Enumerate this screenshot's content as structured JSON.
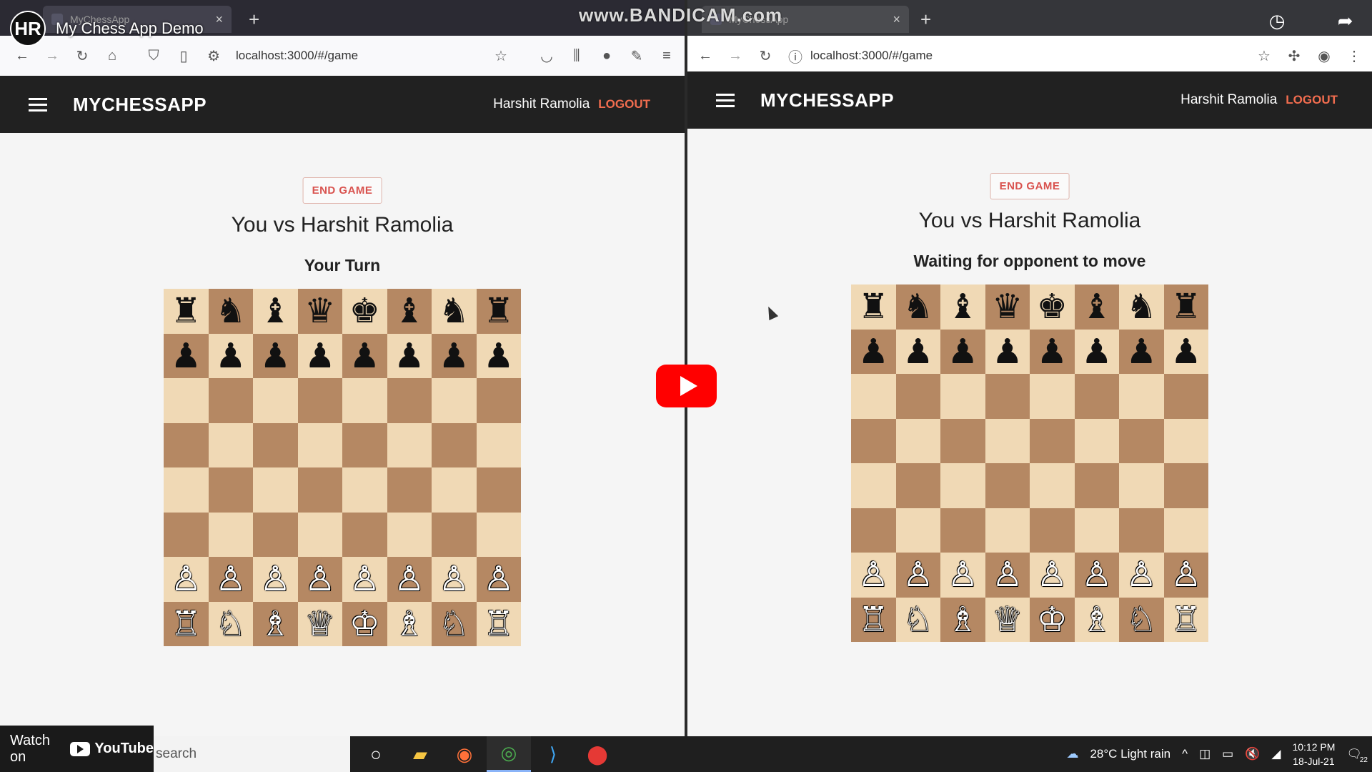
{
  "video": {
    "title": "My Chess App Demo",
    "channel_avatar": "HR",
    "watermark": "www.BANDICAM.com",
    "watch_later": "Watch later",
    "share": "Share",
    "watch_on": "Watch on",
    "youtube": "YouTube"
  },
  "left_browser": {
    "tab_title": "MyChessApp",
    "url": "localhost:3000/#/game"
  },
  "right_browser": {
    "tab_title": "MyChessApp",
    "url": "localhost:3000/#/game"
  },
  "app": {
    "brand": "MYCHESSAPP",
    "user": "Harshit Ramolia",
    "logout": "LOGOUT",
    "end_game": "END GAME",
    "versus": "You vs Harshit Ramolia"
  },
  "left_game": {
    "status": "Your Turn"
  },
  "right_game": {
    "status": "Waiting for opponent to move"
  },
  "board": {
    "rows": [
      [
        "♜",
        "♞",
        "♝",
        "♛",
        "♚",
        "♝",
        "♞",
        "♜"
      ],
      [
        "♟",
        "♟",
        "♟",
        "♟",
        "♟",
        "♟",
        "♟",
        "♟"
      ],
      [
        "",
        "",
        "",
        "",
        "",
        "",
        "",
        ""
      ],
      [
        "",
        "",
        "",
        "",
        "",
        "",
        "",
        ""
      ],
      [
        "",
        "",
        "",
        "",
        "",
        "",
        "",
        ""
      ],
      [
        "",
        "",
        "",
        "",
        "",
        "",
        "",
        ""
      ],
      [
        "♙",
        "♙",
        "♙",
        "♙",
        "♙",
        "♙",
        "♙",
        "♙"
      ],
      [
        "♖",
        "♘",
        "♗",
        "♕",
        "♔",
        "♗",
        "♘",
        "♖"
      ]
    ],
    "light": "#f0d9b5",
    "dark": "#b58863"
  },
  "taskbar": {
    "search_placeholder": "search",
    "weather": "28°C  Light rain",
    "time": "10:12 PM",
    "date": "18-Jul-21",
    "notifications": "22"
  }
}
